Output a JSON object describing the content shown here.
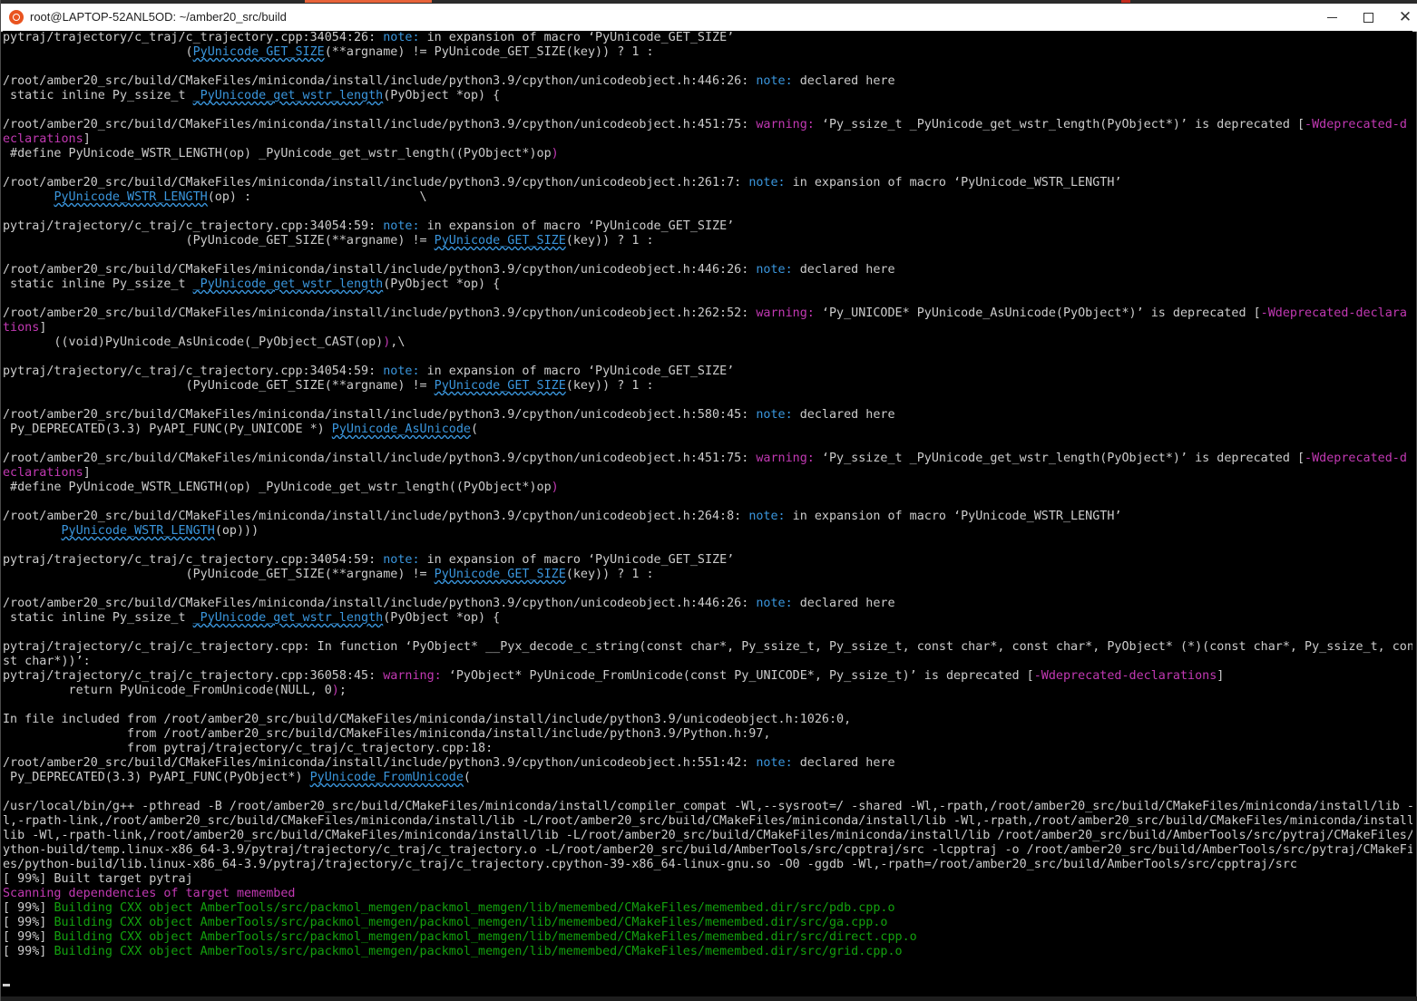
{
  "window": {
    "title": "root@LAPTOP-52ANL5OD: ~/amber20_src/build",
    "controls": {
      "minimize": "—",
      "maximize": "□",
      "close": "✕"
    },
    "icon": "ubuntu-terminal-icon"
  },
  "terminal": {
    "lines": [
      [
        {
          "t": "pytraj/trajectory/c_traj/c_trajectory.cpp:34054:26: ",
          "c": "w"
        },
        {
          "t": "note:",
          "c": "c"
        },
        {
          "t": " in expansion of macro ‘PyUnicode_GET_SIZE’",
          "c": "w"
        }
      ],
      [
        {
          "t": "                         (",
          "c": "w"
        },
        {
          "t": "PyUnicode_GET_SIZE",
          "c": "u"
        },
        {
          "t": "(**argname) != PyUnicode_GET_SIZE(key)) ? 1 :",
          "c": "w"
        }
      ],
      [],
      [
        {
          "t": "/root/amber20_src/build/CMakeFiles/miniconda/install/include/python3.9/cpython/unicodeobject.h:446:26: ",
          "c": "w"
        },
        {
          "t": "note:",
          "c": "c"
        },
        {
          "t": " declared here",
          "c": "w"
        }
      ],
      [
        {
          "t": " static inline Py_ssize_t ",
          "c": "w"
        },
        {
          "t": "_PyUnicode_get_wstr_length",
          "c": "u"
        },
        {
          "t": "(PyObject *op) {",
          "c": "w"
        }
      ],
      [],
      [
        {
          "t": "/root/amber20_src/build/CMakeFiles/miniconda/install/include/python3.9/cpython/unicodeobject.h:451:75: ",
          "c": "w"
        },
        {
          "t": "warning:",
          "c": "m"
        },
        {
          "t": " ‘Py_ssize_t _PyUnicode_get_wstr_length(PyObject*)’ is deprecated [",
          "c": "w"
        },
        {
          "t": "-Wdeprecated-d",
          "c": "m"
        }
      ],
      [
        {
          "t": "eclarations",
          "c": "m"
        },
        {
          "t": "]",
          "c": "w"
        }
      ],
      [
        {
          "t": " #define PyUnicode_WSTR_LENGTH(op) _PyUnicode_get_wstr_length((PyObject*)op",
          "c": "w"
        },
        {
          "t": ")",
          "c": "m"
        }
      ],
      [],
      [
        {
          "t": "/root/amber20_src/build/CMakeFiles/miniconda/install/include/python3.9/cpython/unicodeobject.h:261:7: ",
          "c": "w"
        },
        {
          "t": "note:",
          "c": "c"
        },
        {
          "t": " in expansion of macro ‘PyUnicode_WSTR_LENGTH’",
          "c": "w"
        }
      ],
      [
        {
          "t": "       ",
          "c": "w"
        },
        {
          "t": "PyUnicode_WSTR_LENGTH",
          "c": "u"
        },
        {
          "t": "(op) :                       \\",
          "c": "w"
        }
      ],
      [],
      [
        {
          "t": "pytraj/trajectory/c_traj/c_trajectory.cpp:34054:59: ",
          "c": "w"
        },
        {
          "t": "note:",
          "c": "c"
        },
        {
          "t": " in expansion of macro ‘PyUnicode_GET_SIZE’",
          "c": "w"
        }
      ],
      [
        {
          "t": "                         (PyUnicode_GET_SIZE(**argname) != ",
          "c": "w"
        },
        {
          "t": "PyUnicode_GET_SIZE",
          "c": "u"
        },
        {
          "t": "(key)) ? 1 :",
          "c": "w"
        }
      ],
      [],
      [
        {
          "t": "/root/amber20_src/build/CMakeFiles/miniconda/install/include/python3.9/cpython/unicodeobject.h:446:26: ",
          "c": "w"
        },
        {
          "t": "note:",
          "c": "c"
        },
        {
          "t": " declared here",
          "c": "w"
        }
      ],
      [
        {
          "t": " static inline Py_ssize_t ",
          "c": "w"
        },
        {
          "t": "_PyUnicode_get_wstr_length",
          "c": "u"
        },
        {
          "t": "(PyObject *op) {",
          "c": "w"
        }
      ],
      [],
      [
        {
          "t": "/root/amber20_src/build/CMakeFiles/miniconda/install/include/python3.9/cpython/unicodeobject.h:262:52: ",
          "c": "w"
        },
        {
          "t": "warning:",
          "c": "m"
        },
        {
          "t": " ‘Py_UNICODE* PyUnicode_AsUnicode(PyObject*)’ is deprecated [",
          "c": "w"
        },
        {
          "t": "-Wdeprecated-declara",
          "c": "m"
        }
      ],
      [
        {
          "t": "tions",
          "c": "m"
        },
        {
          "t": "]",
          "c": "w"
        }
      ],
      [
        {
          "t": "       ((void)PyUnicode_AsUnicode(_PyObject_CAST(op)",
          "c": "w"
        },
        {
          "t": ")",
          "c": "m"
        },
        {
          "t": ",\\",
          "c": "w"
        }
      ],
      [],
      [
        {
          "t": "pytraj/trajectory/c_traj/c_trajectory.cpp:34054:59: ",
          "c": "w"
        },
        {
          "t": "note:",
          "c": "c"
        },
        {
          "t": " in expansion of macro ‘PyUnicode_GET_SIZE’",
          "c": "w"
        }
      ],
      [
        {
          "t": "                         (PyUnicode_GET_SIZE(**argname) != ",
          "c": "w"
        },
        {
          "t": "PyUnicode_GET_SIZE",
          "c": "u"
        },
        {
          "t": "(key)) ? 1 :",
          "c": "w"
        }
      ],
      [],
      [
        {
          "t": "/root/amber20_src/build/CMakeFiles/miniconda/install/include/python3.9/cpython/unicodeobject.h:580:45: ",
          "c": "w"
        },
        {
          "t": "note:",
          "c": "c"
        },
        {
          "t": " declared here",
          "c": "w"
        }
      ],
      [
        {
          "t": " Py_DEPRECATED(3.3) PyAPI_FUNC(Py_UNICODE *) ",
          "c": "w"
        },
        {
          "t": "PyUnicode_AsUnicode",
          "c": "u"
        },
        {
          "t": "(",
          "c": "w"
        }
      ],
      [],
      [
        {
          "t": "/root/amber20_src/build/CMakeFiles/miniconda/install/include/python3.9/cpython/unicodeobject.h:451:75: ",
          "c": "w"
        },
        {
          "t": "warning:",
          "c": "m"
        },
        {
          "t": " ‘Py_ssize_t _PyUnicode_get_wstr_length(PyObject*)’ is deprecated [",
          "c": "w"
        },
        {
          "t": "-Wdeprecated-d",
          "c": "m"
        }
      ],
      [
        {
          "t": "eclarations",
          "c": "m"
        },
        {
          "t": "]",
          "c": "w"
        }
      ],
      [
        {
          "t": " #define PyUnicode_WSTR_LENGTH(op) _PyUnicode_get_wstr_length((PyObject*)op",
          "c": "w"
        },
        {
          "t": ")",
          "c": "m"
        }
      ],
      [],
      [
        {
          "t": "/root/amber20_src/build/CMakeFiles/miniconda/install/include/python3.9/cpython/unicodeobject.h:264:8: ",
          "c": "w"
        },
        {
          "t": "note:",
          "c": "c"
        },
        {
          "t": " in expansion of macro ‘PyUnicode_WSTR_LENGTH’",
          "c": "w"
        }
      ],
      [
        {
          "t": "        ",
          "c": "w"
        },
        {
          "t": "PyUnicode_WSTR_LENGTH",
          "c": "u"
        },
        {
          "t": "(op)))",
          "c": "w"
        }
      ],
      [],
      [
        {
          "t": "pytraj/trajectory/c_traj/c_trajectory.cpp:34054:59: ",
          "c": "w"
        },
        {
          "t": "note:",
          "c": "c"
        },
        {
          "t": " in expansion of macro ‘PyUnicode_GET_SIZE’",
          "c": "w"
        }
      ],
      [
        {
          "t": "                         (PyUnicode_GET_SIZE(**argname) != ",
          "c": "w"
        },
        {
          "t": "PyUnicode_GET_SIZE",
          "c": "u"
        },
        {
          "t": "(key)) ? 1 :",
          "c": "w"
        }
      ],
      [],
      [
        {
          "t": "/root/amber20_src/build/CMakeFiles/miniconda/install/include/python3.9/cpython/unicodeobject.h:446:26: ",
          "c": "w"
        },
        {
          "t": "note:",
          "c": "c"
        },
        {
          "t": " declared here",
          "c": "w"
        }
      ],
      [
        {
          "t": " static inline Py_ssize_t ",
          "c": "w"
        },
        {
          "t": "_PyUnicode_get_wstr_length",
          "c": "u"
        },
        {
          "t": "(PyObject *op) {",
          "c": "w"
        }
      ],
      [],
      [
        {
          "t": "pytraj/trajectory/c_traj/c_trajectory.cpp: In function ‘PyObject* __Pyx_decode_c_string(const char*, Py_ssize_t, Py_ssize_t, const char*, const char*, PyObject* (*)(const char*, Py_ssize_t, con",
          "c": "w"
        }
      ],
      [
        {
          "t": "st char*))’:",
          "c": "w"
        }
      ],
      [
        {
          "t": "pytraj/trajectory/c_traj/c_trajectory.cpp:36058:45: ",
          "c": "w"
        },
        {
          "t": "warning:",
          "c": "m"
        },
        {
          "t": " ‘PyObject* PyUnicode_FromUnicode(const Py_UNICODE*, Py_ssize_t)’ is deprecated [",
          "c": "w"
        },
        {
          "t": "-Wdeprecated-declarations",
          "c": "m"
        },
        {
          "t": "]",
          "c": "w"
        }
      ],
      [
        {
          "t": "         return PyUnicode_FromUnicode(NULL, 0",
          "c": "w"
        },
        {
          "t": ")",
          "c": "m"
        },
        {
          "t": ";",
          "c": "w"
        }
      ],
      [],
      [
        {
          "t": "In file included from /root/amber20_src/build/CMakeFiles/miniconda/install/include/python3.9/unicodeobject.h:1026:0,",
          "c": "w"
        }
      ],
      [
        {
          "t": "                 from /root/amber20_src/build/CMakeFiles/miniconda/install/include/python3.9/Python.h:97,",
          "c": "w"
        }
      ],
      [
        {
          "t": "                 from pytraj/trajectory/c_traj/c_trajectory.cpp:18:",
          "c": "w"
        }
      ],
      [
        {
          "t": "/root/amber20_src/build/CMakeFiles/miniconda/install/include/python3.9/cpython/unicodeobject.h:551:42: ",
          "c": "w"
        },
        {
          "t": "note:",
          "c": "c"
        },
        {
          "t": " declared here",
          "c": "w"
        }
      ],
      [
        {
          "t": " Py_DEPRECATED(3.3) PyAPI_FUNC(PyObject*) ",
          "c": "w"
        },
        {
          "t": "PyUnicode_FromUnicode",
          "c": "u"
        },
        {
          "t": "(",
          "c": "w"
        }
      ],
      [],
      [
        {
          "t": "/usr/local/bin/g++ -pthread -B /root/amber20_src/build/CMakeFiles/miniconda/install/compiler_compat -Wl,--sysroot=/ -shared -Wl,-rpath,/root/amber20_src/build/CMakeFiles/miniconda/install/lib -W",
          "c": "w"
        }
      ],
      [
        {
          "t": "l,-rpath-link,/root/amber20_src/build/CMakeFiles/miniconda/install/lib -L/root/amber20_src/build/CMakeFiles/miniconda/install/lib -Wl,-rpath,/root/amber20_src/build/CMakeFiles/miniconda/install/",
          "c": "w"
        }
      ],
      [
        {
          "t": "lib -Wl,-rpath-link,/root/amber20_src/build/CMakeFiles/miniconda/install/lib -L/root/amber20_src/build/CMakeFiles/miniconda/install/lib /root/amber20_src/build/AmberTools/src/pytraj/CMakeFiles/p",
          "c": "w"
        }
      ],
      [
        {
          "t": "ython-build/temp.linux-x86_64-3.9/pytraj/trajectory/c_traj/c_trajectory.o -L/root/amber20_src/build/AmberTools/src/cpptraj/src -lcpptraj -o /root/amber20_src/build/AmberTools/src/pytraj/CMakeFil",
          "c": "w"
        }
      ],
      [
        {
          "t": "es/python-build/lib.linux-x86_64-3.9/pytraj/trajectory/c_traj/c_trajectory.cpython-39-x86_64-linux-gnu.so -O0 -ggdb -Wl,-rpath=/root/amber20_src/build/AmberTools/src/cpptraj/src",
          "c": "w"
        }
      ],
      [
        {
          "t": "[ 99%] Built target pytraj",
          "c": "w"
        }
      ],
      [
        {
          "t": "Scanning dependencies of target memembed",
          "c": "m"
        }
      ],
      [
        {
          "t": "[ 99%] ",
          "c": "w"
        },
        {
          "t": "Building CXX object AmberTools/src/packmol_memgen/packmol_memgen/lib/memembed/CMakeFiles/memembed.dir/src/pdb.cpp.o",
          "c": "g"
        }
      ],
      [
        {
          "t": "[ 99%] ",
          "c": "w"
        },
        {
          "t": "Building CXX object AmberTools/src/packmol_memgen/packmol_memgen/lib/memembed/CMakeFiles/memembed.dir/src/ga.cpp.o",
          "c": "g"
        }
      ],
      [
        {
          "t": "[ 99%] ",
          "c": "w"
        },
        {
          "t": "Building CXX object AmberTools/src/packmol_memgen/packmol_memgen/lib/memembed/CMakeFiles/memembed.dir/src/direct.cpp.o",
          "c": "g"
        }
      ],
      [
        {
          "t": "[ 99%] ",
          "c": "w"
        },
        {
          "t": "Building CXX object AmberTools/src/packmol_memgen/packmol_memgen/lib/memembed/CMakeFiles/memembed.dir/src/grid.cpp.o",
          "c": "g"
        }
      ]
    ]
  }
}
